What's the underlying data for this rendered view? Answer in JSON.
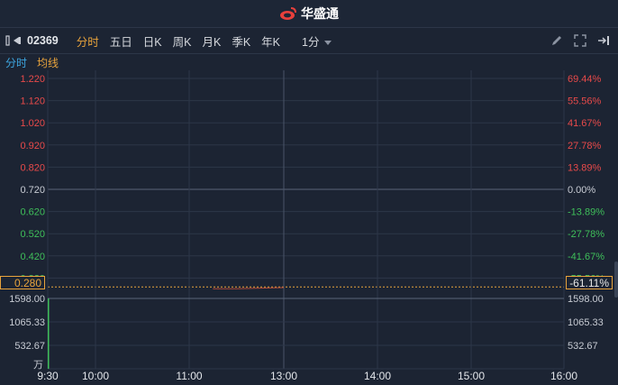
{
  "header": {
    "app_name": "华盛通"
  },
  "toolbar": {
    "code": "02369",
    "periods": [
      {
        "label": "分时",
        "active": true
      },
      {
        "label": "五日",
        "active": false
      },
      {
        "label": "日K",
        "active": false
      },
      {
        "label": "周K",
        "active": false
      },
      {
        "label": "月K",
        "active": false
      },
      {
        "label": "季K",
        "active": false
      },
      {
        "label": "年K",
        "active": false
      }
    ],
    "minute_select": "1分",
    "icons": [
      "pen-icon",
      "fullscreen-icon",
      "exit-icon"
    ]
  },
  "subbar": {
    "tab_a": "分时",
    "tab_b": "均线"
  },
  "chart_data": {
    "type": "line",
    "title": "",
    "price_ticks_left": [
      "1.220",
      "1.120",
      "1.020",
      "0.920",
      "0.820",
      "0.720",
      "0.620",
      "0.520",
      "0.420",
      "0.320"
    ],
    "price_tick_values": [
      1.22,
      1.12,
      1.02,
      0.92,
      0.82,
      0.72,
      0.62,
      0.52,
      0.42,
      0.32
    ],
    "pct_ticks_right": [
      "69.44%",
      "55.56%",
      "41.67%",
      "27.78%",
      "13.89%",
      "0.00%",
      "-13.89%",
      "-27.78%",
      "-41.67%",
      "-55.56%"
    ],
    "prev_close": 0.72,
    "last_price": "0.280",
    "last_change": "-61.11%",
    "volume_ticks_left": [
      "1598.00",
      "1065.33",
      "532.67"
    ],
    "volume_ticks_right": [
      "1598.00",
      "1065.33",
      "532.67"
    ],
    "volume_unit": "万",
    "x_ticks": [
      "9:30",
      "10:00",
      "11:00",
      "13:00",
      "14:00",
      "15:00",
      "16:00"
    ],
    "series": [
      {
        "x": [
          "11:30",
          "12:00",
          "13:00"
        ],
        "values": [
          0.28,
          0.28,
          0.285
        ]
      }
    ],
    "volume": [
      {
        "x": "9:30",
        "value": 1598
      }
    ],
    "colors": {
      "up": "#e84a4a",
      "down": "#3fbf5a",
      "neutral": "#c8ccd4",
      "accent": "#e8a33c",
      "grid": "#2c3648"
    },
    "grid": true
  }
}
